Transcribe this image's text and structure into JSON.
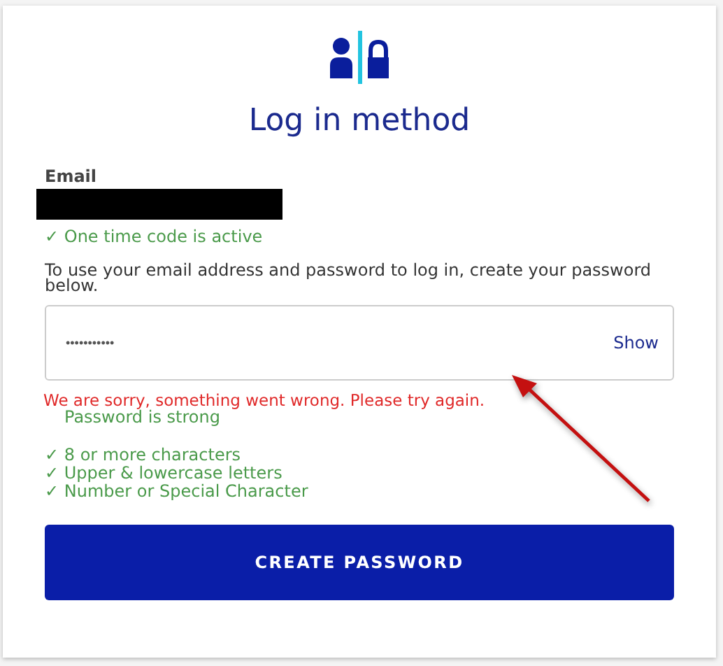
{
  "title": "Log in method",
  "email": {
    "label": "Email"
  },
  "one_time_code": "✓ One time code is active",
  "instruction": "To use your email address and password to log in, create your password below.",
  "password_field": {
    "value": "•••••••••••",
    "toggle": "Show"
  },
  "error": "We are sorry, something went wrong. Please try again.",
  "strength": "Password is strong",
  "requirements": [
    "✓ 8 or more characters",
    "✓ Upper & lowercase letters",
    "✓ Number or Special Character"
  ],
  "button": "CREATE PASSWORD"
}
